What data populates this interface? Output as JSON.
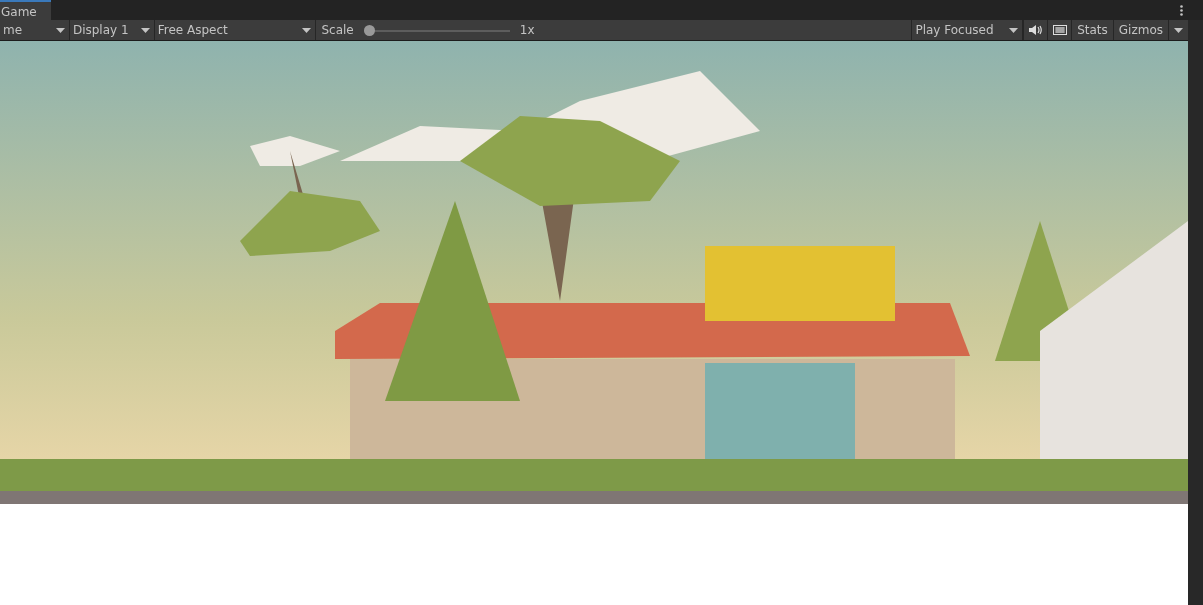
{
  "tab": {
    "label": "Game",
    "selected": true
  },
  "toolbar": {
    "view_menu": "me",
    "display": "Display 1",
    "aspect": "Free Aspect",
    "scale": {
      "label": "Scale",
      "level": 0,
      "reading": "1x"
    },
    "play_mode": "Play Focused",
    "stats": "Stats",
    "gizmos": "Gizmos"
  }
}
